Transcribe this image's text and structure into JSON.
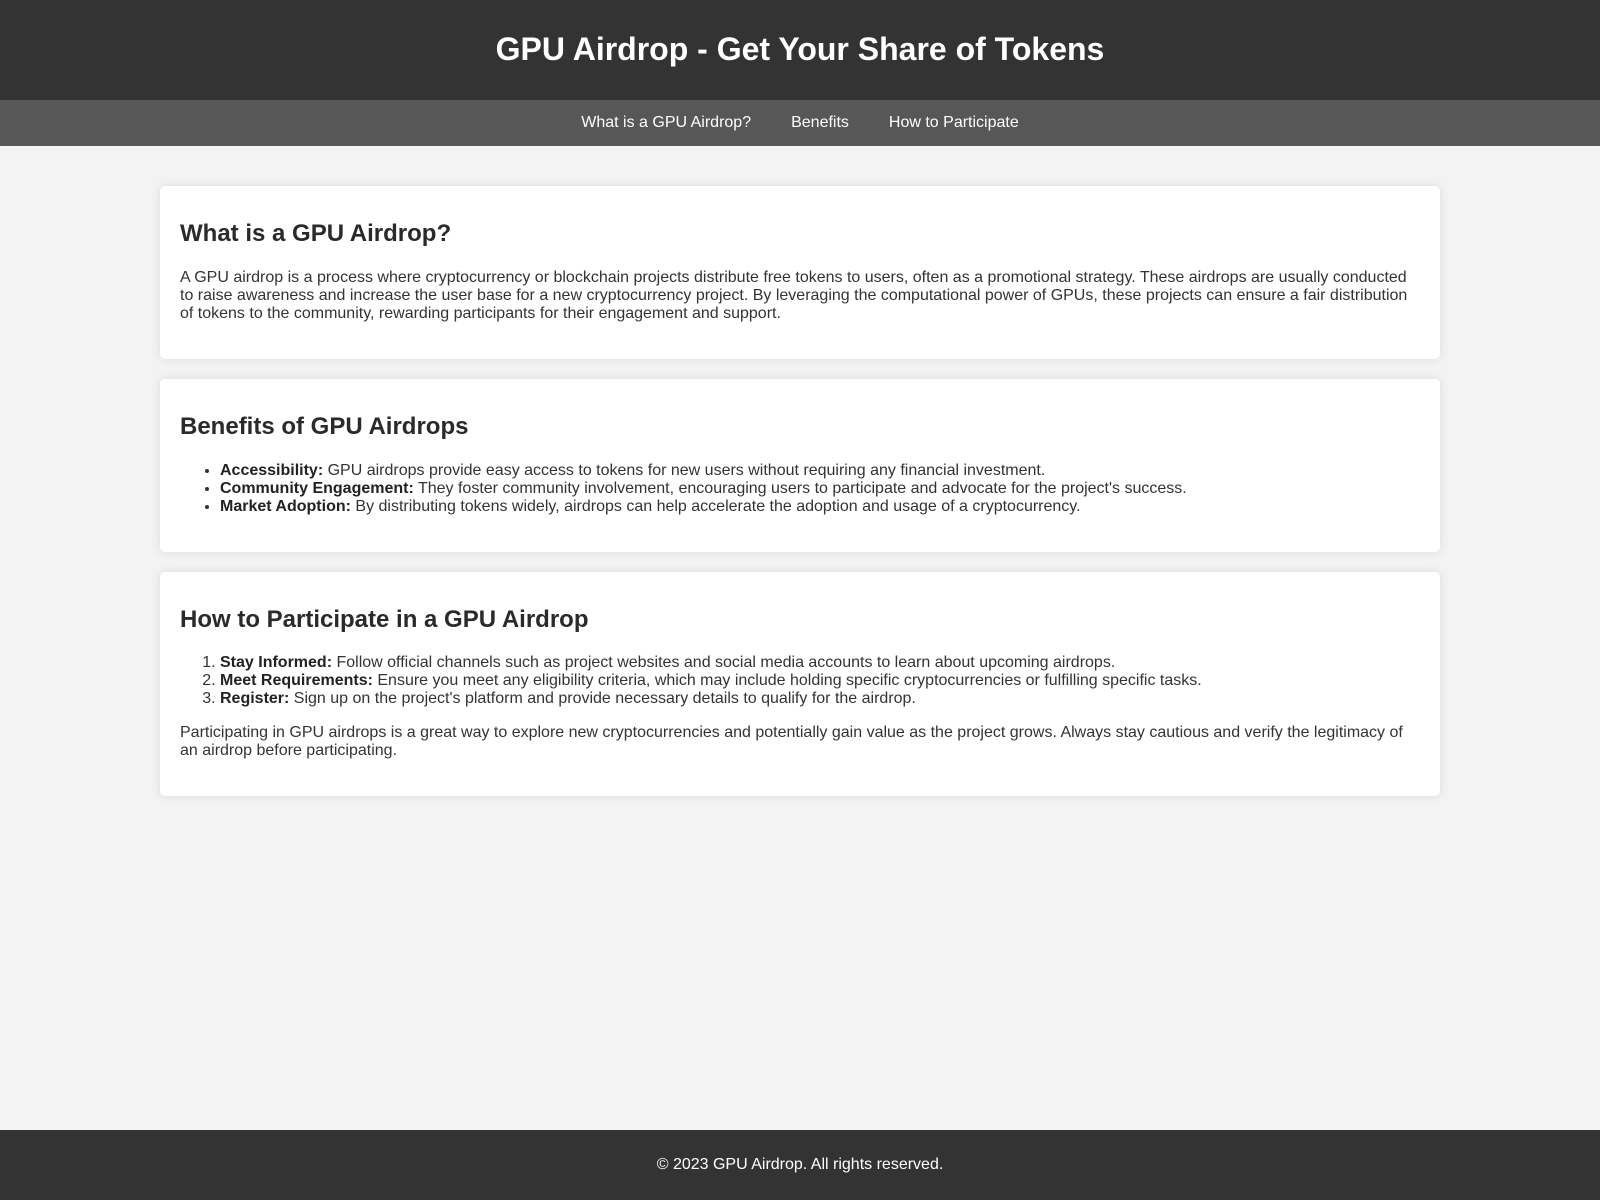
{
  "header": {
    "title": "GPU Airdrop - Get Your Share of Tokens"
  },
  "nav": {
    "items": [
      {
        "label": "What is a GPU Airdrop?"
      },
      {
        "label": "Benefits"
      },
      {
        "label": "How to Participate"
      }
    ]
  },
  "sections": {
    "what": {
      "heading": "What is a GPU Airdrop?",
      "paragraph": "A GPU airdrop is a process where cryptocurrency or blockchain projects distribute free tokens to users, often as a promotional strategy. These airdrops are usually conducted to raise awareness and increase the user base for a new cryptocurrency project. By leveraging the computational power of GPUs, these projects can ensure a fair distribution of tokens to the community, rewarding participants for their engagement and support."
    },
    "benefits": {
      "heading": "Benefits of GPU Airdrops",
      "items": [
        {
          "term": "Accessibility:",
          "text": " GPU airdrops provide easy access to tokens for new users without requiring any financial investment."
        },
        {
          "term": "Community Engagement:",
          "text": " They foster community involvement, encouraging users to participate and advocate for the project's success."
        },
        {
          "term": "Market Adoption:",
          "text": " By distributing tokens widely, airdrops can help accelerate the adoption and usage of a cryptocurrency."
        }
      ]
    },
    "participate": {
      "heading": "How to Participate in a GPU Airdrop",
      "steps": [
        {
          "term": "Stay Informed:",
          "text": " Follow official channels such as project websites and social media accounts to learn about upcoming airdrops."
        },
        {
          "term": "Meet Requirements:",
          "text": " Ensure you meet any eligibility criteria, which may include holding specific cryptocurrencies or fulfilling specific tasks."
        },
        {
          "term": "Register:",
          "text": " Sign up on the project's platform and provide necessary details to qualify for the airdrop."
        }
      ],
      "paragraph": "Participating in GPU airdrops is a great way to explore new cryptocurrencies and potentially gain value as the project grows. Always stay cautious and verify the legitimacy of an airdrop before participating."
    }
  },
  "footer": {
    "text": "© 2023 GPU Airdrop. All rights reserved."
  },
  "colors": {
    "header_bg": "#333333",
    "nav_bg": "#575757",
    "page_bg": "#f3f3f3",
    "card_bg": "#ffffff"
  }
}
